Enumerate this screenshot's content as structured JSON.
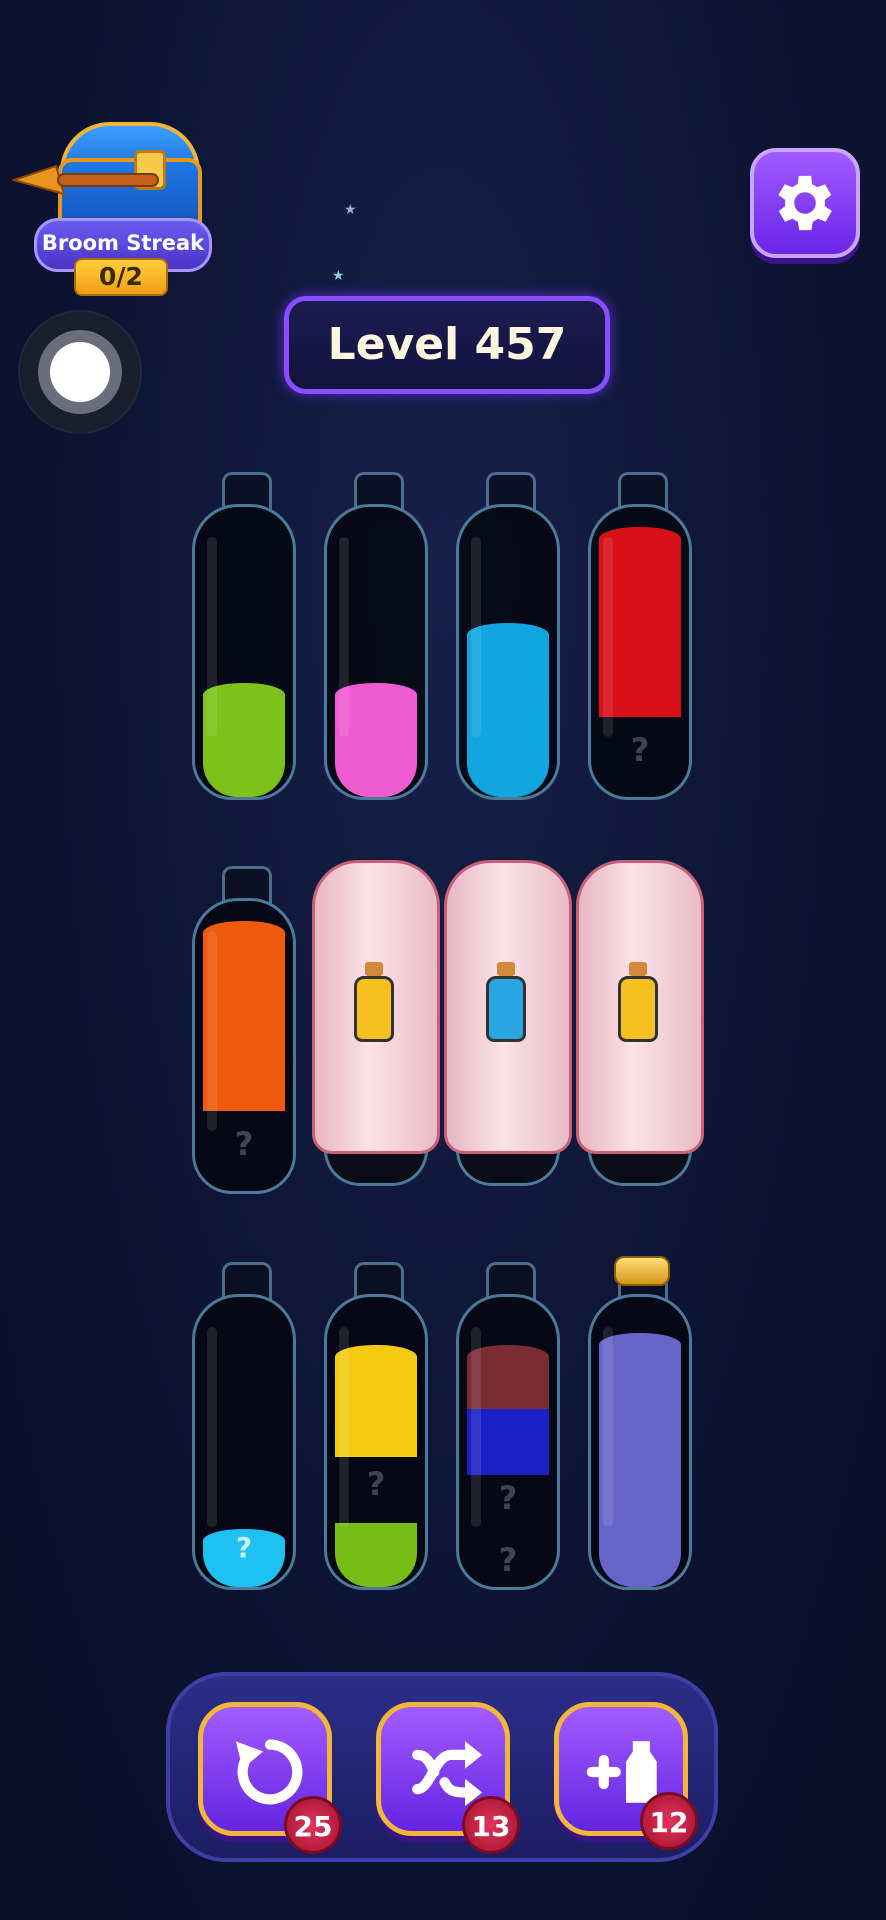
{
  "streak": {
    "label": "Broom Streak",
    "count": "0/2"
  },
  "level": {
    "label": "Level 457"
  },
  "bottles_row1": [
    {
      "color": "#7cc21a",
      "fill": 0.4
    },
    {
      "color": "#ef5bd0",
      "fill": 0.4
    },
    {
      "color": "#12a6e0",
      "fill": 0.6
    },
    {
      "color": "#d8101a",
      "fill": 0.6,
      "hidden": "?"
    }
  ],
  "bottle_orange": {
    "color": "#ef5a0c",
    "hidden": "?"
  },
  "covered": [
    {
      "color": "#f6c021"
    },
    {
      "color": "#2aa7e2"
    },
    {
      "color": "#f6c021"
    }
  ],
  "bottles_row3": [
    {
      "color": "#1fc1f2",
      "mystery": "?"
    },
    {
      "top": "#f2cb12",
      "mid": "?",
      "bottom": "#78bd16"
    },
    {
      "top": "#7a2b34",
      "mid": "#1a1fc6",
      "q1": "?",
      "q2": "?"
    },
    {
      "color": "#6865c9",
      "sealed": true
    }
  ],
  "powerups": {
    "undo": "25",
    "shuffle": "13",
    "add_bottle": "12"
  }
}
